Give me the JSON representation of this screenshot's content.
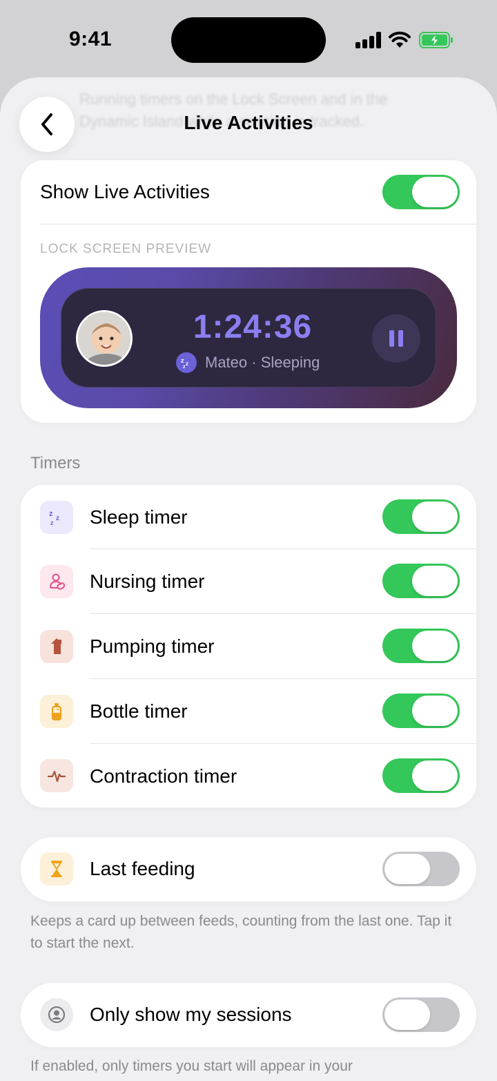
{
  "status_bar": {
    "time": "9:41"
  },
  "ghost_text": "Running timers on the Lock Screen and in the Dynamic Island while a session is tracked.",
  "nav": {
    "title": "Live Activities",
    "back_icon": "chevron-left-icon"
  },
  "main_toggle": {
    "label": "Show Live Activities",
    "on": true
  },
  "preview": {
    "section_label": "LOCK SCREEN PREVIEW",
    "timer": "1:24:36",
    "subtitle": "Mateo · Sleeping",
    "colors": {
      "accent": "#8b7ef0",
      "gradient_start": "#5a4fb8",
      "gradient_end": "#4a2a3e"
    }
  },
  "timers_section": {
    "label": "Timers",
    "items": [
      {
        "label": "Sleep timer",
        "icon": "sleep-zz-icon",
        "icon_bg": "#ebe9fb",
        "on": true
      },
      {
        "label": "Nursing timer",
        "icon": "nursing-icon",
        "icon_bg": "#fde8ee",
        "on": true
      },
      {
        "label": "Pumping timer",
        "icon": "pump-icon",
        "icon_bg": "#f8e2dc",
        "on": true
      },
      {
        "label": "Bottle timer",
        "icon": "bottle-icon",
        "icon_bg": "#fdf0d8",
        "on": true
      },
      {
        "label": "Contraction timer",
        "icon": "pulse-icon",
        "icon_bg": "#f6e6df",
        "on": true
      }
    ]
  },
  "last_feeding": {
    "label": "Last feeding",
    "icon": "hourglass-icon",
    "on": false,
    "footnote": "Keeps a card up between feeds, counting from the last one. Tap it to start the next."
  },
  "only_my_sessions": {
    "label": "Only show my sessions",
    "icon": "person-circle-icon",
    "on": false,
    "footnote": "If enabled, only timers you start will appear in your"
  },
  "colors": {
    "toggle_on": "#34c759",
    "toggle_off": "#c7c7cb"
  }
}
